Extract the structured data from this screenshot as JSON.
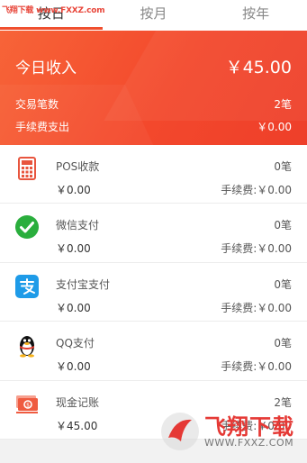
{
  "watermark_text": "飞翔下载 www.FXXZ.com",
  "tabs": [
    {
      "label": "按日",
      "active": true
    },
    {
      "label": "按月",
      "active": false
    },
    {
      "label": "按年",
      "active": false
    }
  ],
  "summary": {
    "income_label": "今日收入",
    "income_value": "￥45.00",
    "tx_count_label": "交易笔数",
    "tx_count_value": "2笔",
    "fee_label": "手续费支出",
    "fee_value": "￥0.00"
  },
  "payment_methods": [
    {
      "name": "POS收款",
      "icon": "pos-terminal-icon",
      "count": "0笔",
      "amount": "￥0.00",
      "fee": "手续费:￥0.00"
    },
    {
      "name": "微信支付",
      "icon": "wechat-icon",
      "count": "0笔",
      "amount": "￥0.00",
      "fee": "手续费:￥0.00"
    },
    {
      "name": "支付宝支付",
      "icon": "alipay-icon",
      "count": "0笔",
      "amount": "￥0.00",
      "fee": "手续费:￥0.00"
    },
    {
      "name": "QQ支付",
      "icon": "qq-penguin-icon",
      "count": "0笔",
      "amount": "￥0.00",
      "fee": "手续费:￥0.00"
    },
    {
      "name": "现金记账",
      "icon": "cash-icon",
      "count": "2笔",
      "amount": "￥45.00",
      "fee": "手续费:￥0.00"
    }
  ],
  "logo": {
    "word": "飞翔下载",
    "url": "WWW.FXXZ.COM"
  },
  "colors": {
    "accent": "#f04f2e",
    "banner": "#f3482c"
  }
}
